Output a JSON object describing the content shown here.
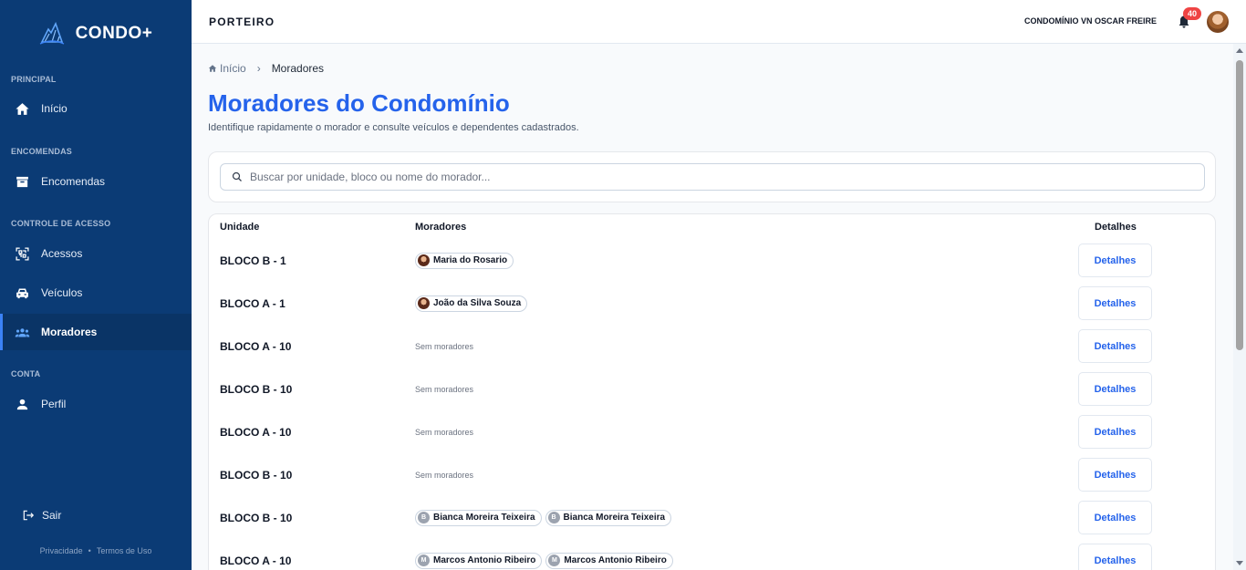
{
  "brand": {
    "name": "CONDO+"
  },
  "sidebar": {
    "sections": [
      {
        "label": "PRINCIPAL"
      },
      {
        "label": "ENCOMENDAS"
      },
      {
        "label": "CONTROLE DE ACESSO"
      },
      {
        "label": "CONTA"
      }
    ],
    "items": [
      {
        "label": "Início",
        "icon": "home-icon"
      },
      {
        "label": "Encomendas",
        "icon": "archive-box-icon"
      },
      {
        "label": "Acessos",
        "icon": "qr-scan-icon"
      },
      {
        "label": "Veículos",
        "icon": "car-icon"
      },
      {
        "label": "Moradores",
        "icon": "users-icon",
        "active": true
      },
      {
        "label": "Perfil",
        "icon": "person-icon"
      }
    ],
    "logout_label": "Sair",
    "footer": {
      "privacy": "Privacidade",
      "separator": "•",
      "terms": "Termos de Uso"
    }
  },
  "topbar": {
    "title": "PORTEIRO",
    "condo_name": "CONDOMÍNIO VN OSCAR FREIRE",
    "notification_count": "40"
  },
  "breadcrumb": {
    "home": "Início",
    "separator": "›",
    "current": "Moradores"
  },
  "page": {
    "title": "Moradores do Condomínio",
    "subtitle": "Identifique rapidamente o morador e consulte veículos e dependentes cadastrados."
  },
  "search": {
    "placeholder": "Buscar por unidade, bloco ou nome do morador..."
  },
  "table": {
    "headers": {
      "unit": "Unidade",
      "residents": "Moradores",
      "details": "Detalhes"
    },
    "empty_label": "Sem moradores",
    "details_label": "Detalhes",
    "rows": [
      {
        "unit": "BLOCO B - 1",
        "residents": [
          {
            "name": "Maria do Rosario",
            "avatar": "photo"
          }
        ]
      },
      {
        "unit": "BLOCO A - 1",
        "residents": [
          {
            "name": "João da Silva Souza",
            "avatar": "photo"
          }
        ]
      },
      {
        "unit": "BLOCO A - 10",
        "residents": []
      },
      {
        "unit": "BLOCO B - 10",
        "residents": []
      },
      {
        "unit": "BLOCO A - 10",
        "residents": []
      },
      {
        "unit": "BLOCO B - 10",
        "residents": []
      },
      {
        "unit": "BLOCO B - 10",
        "residents": [
          {
            "name": "Bianca Moreira Teixeira",
            "initial": "B"
          },
          {
            "name": "Bianca Moreira Teixeira",
            "initial": "B"
          }
        ]
      },
      {
        "unit": "BLOCO A - 10",
        "residents": [
          {
            "name": "Marcos Antonio Ribeiro",
            "initial": "M"
          },
          {
            "name": "Marcos Antonio Ribeiro",
            "initial": "M"
          }
        ]
      }
    ]
  },
  "colors": {
    "sidebar_bg": "#0b3b75",
    "accent": "#2563eb",
    "badge": "#ef4444"
  }
}
